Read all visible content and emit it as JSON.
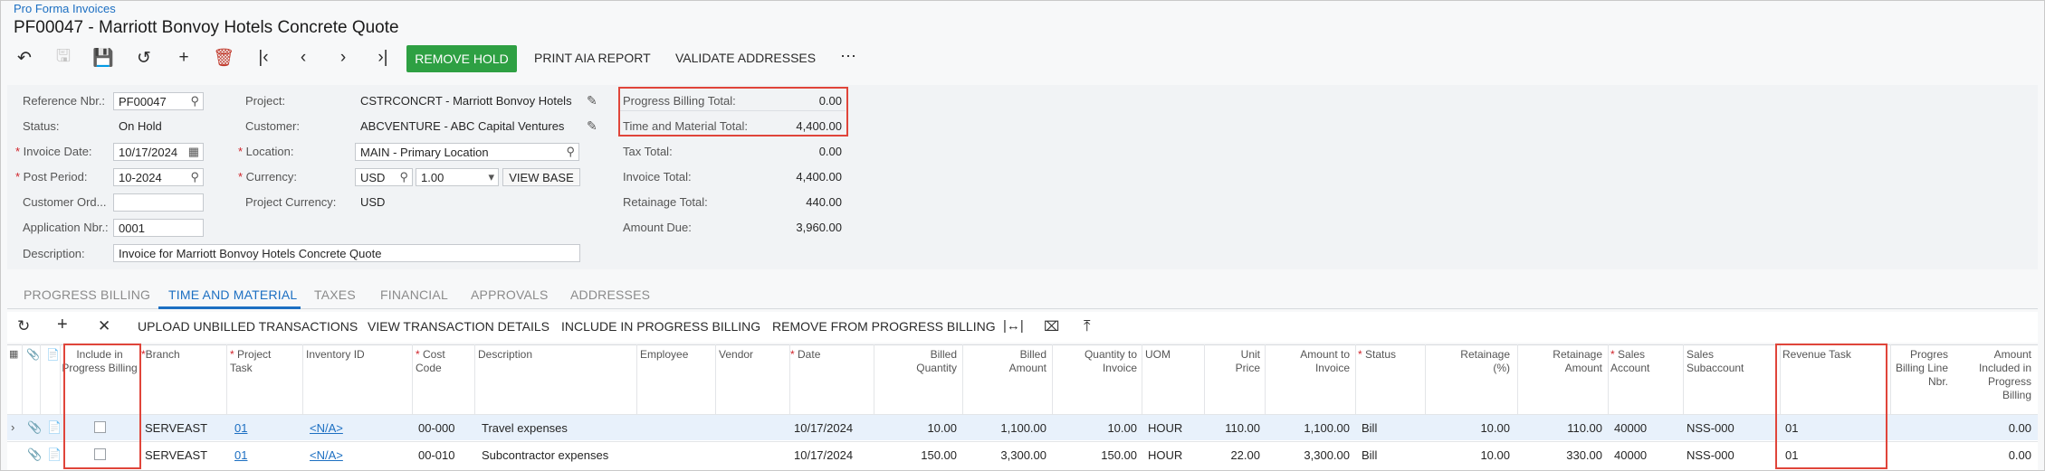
{
  "breadcrumb": "Pro Forma Invoices",
  "title": "PF00047 - Marriott Bonvoy Hotels Concrete Quote",
  "toolbar": {
    "remove_hold": "REMOVE HOLD",
    "print_aia": "PRINT AIA REPORT",
    "validate_addresses": "VALIDATE ADDRESSES",
    "more": "⋯"
  },
  "form": {
    "reference_nbr": {
      "label": "Reference Nbr.:",
      "value": "PF00047"
    },
    "status": {
      "label": "Status:",
      "value": "On Hold"
    },
    "invoice_date": {
      "label": "Invoice Date:",
      "value": "10/17/2024"
    },
    "post_period": {
      "label": "Post Period:",
      "value": "10-2024"
    },
    "customer_ord": {
      "label": "Customer Ord...",
      "value": ""
    },
    "application_nbr": {
      "label": "Application Nbr.:",
      "value": "0001"
    },
    "description": {
      "label": "Description:",
      "value": "Invoice for Marriott Bonvoy Hotels Concrete Quote"
    },
    "project": {
      "label": "Project:",
      "value": "CSTRCONCRT - Marriott Bonvoy Hotels"
    },
    "customer": {
      "label": "Customer:",
      "value": "ABCVENTURE - ABC Capital Ventures"
    },
    "location": {
      "label": "Location:",
      "value": "MAIN - Primary Location"
    },
    "currency": {
      "label": "Currency:",
      "value": "USD",
      "rate": "1.00",
      "view_base": "VIEW BASE"
    },
    "project_currency": {
      "label": "Project Currency:",
      "value": "USD"
    }
  },
  "totals": [
    {
      "label": "Progress Billing Total:",
      "value": "0.00"
    },
    {
      "label": "Time and Material Total:",
      "value": "4,400.00"
    },
    {
      "label": "Tax Total:",
      "value": "0.00"
    },
    {
      "label": "Invoice Total:",
      "value": "4,400.00"
    },
    {
      "label": "Retainage Total:",
      "value": "440.00"
    },
    {
      "label": "Amount Due:",
      "value": "3,960.00"
    }
  ],
  "tabs": [
    "PROGRESS BILLING",
    "TIME AND MATERIAL",
    "TAXES",
    "FINANCIAL",
    "APPROVALS",
    "ADDRESSES"
  ],
  "grid_toolbar": {
    "upload": "UPLOAD UNBILLED TRANSACTIONS",
    "view_details": "VIEW TRANSACTION DETAILS",
    "include": "INCLUDE IN PROGRESS BILLING",
    "remove": "REMOVE FROM PROGRESS BILLING"
  },
  "columns": {
    "include": "Include in Progress Billing",
    "branch": "Branch",
    "project_task": "Project Task",
    "inventory_id": "Inventory ID",
    "cost_code": "Cost Code",
    "description": "Description",
    "employee": "Employee",
    "vendor": "Vendor",
    "date": "Date",
    "billed_quantity": "Billed Quantity",
    "billed_amount": "Billed Amount",
    "qty_to_invoice": "Quantity to Invoice",
    "uom": "UOM",
    "unit_price": "Unit Price",
    "amount_to_invoice": "Amount to Invoice",
    "status": "Status",
    "retainage_pct": "Retainage (%)",
    "retainage_amount": "Retainage Amount",
    "sales_account": "Sales Account",
    "sales_subaccount": "Sales Subaccount",
    "revenue_task": "Revenue Task",
    "pb_line_nbr": "Progres Billing Line Nbr.",
    "amount_included": "Amount Included in Progress Billing"
  },
  "rows": [
    {
      "branch": "SERVEAST",
      "project_task": "01",
      "inventory_id": "<N/A>",
      "cost_code": "00-000",
      "description": "Travel expenses",
      "employee": "",
      "vendor": "",
      "date": "10/17/2024",
      "billed_quantity": "10.00",
      "billed_amount": "1,100.00",
      "qty_to_invoice": "10.00",
      "uom": "HOUR",
      "unit_price": "110.00",
      "amount_to_invoice": "1,100.00",
      "status": "Bill",
      "retainage_pct": "10.00",
      "retainage_amount": "110.00",
      "sales_account": "40000",
      "sales_subaccount": "NSS-000",
      "revenue_task": "01",
      "pb_line_nbr": "",
      "amount_included": "0.00"
    },
    {
      "branch": "SERVEAST",
      "project_task": "01",
      "inventory_id": "<N/A>",
      "cost_code": "00-010",
      "description": "Subcontractor expenses",
      "employee": "",
      "vendor": "",
      "date": "10/17/2024",
      "billed_quantity": "150.00",
      "billed_amount": "3,300.00",
      "qty_to_invoice": "150.00",
      "uom": "HOUR",
      "unit_price": "22.00",
      "amount_to_invoice": "3,300.00",
      "status": "Bill",
      "retainage_pct": "10.00",
      "retainage_amount": "330.00",
      "sales_account": "40000",
      "sales_subaccount": "NSS-000",
      "revenue_task": "01",
      "pb_line_nbr": "",
      "amount_included": "0.00"
    }
  ],
  "colors": {
    "accent": "#1c6fc2",
    "green": "#2ea043",
    "highlight": "#e0453a"
  }
}
